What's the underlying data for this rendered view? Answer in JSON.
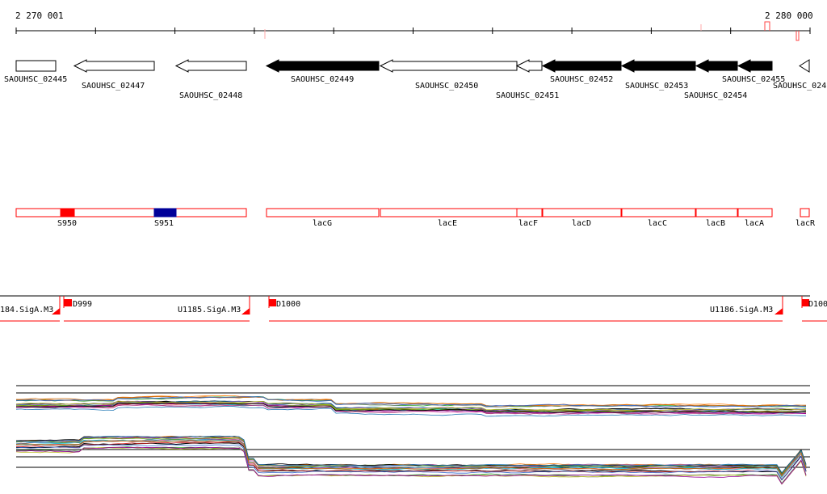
{
  "ruler": {
    "start_label": "2 270 001",
    "end_label": "2 280 000"
  },
  "genes": [
    {
      "label": "SAOUHSC_02445",
      "fill": "white",
      "dir": "box"
    },
    {
      "label": "SAOUHSC_02447",
      "fill": "white",
      "dir": "left"
    },
    {
      "label": "SAOUHSC_02448",
      "fill": "white",
      "dir": "left"
    },
    {
      "label": "SAOUHSC_02449",
      "fill": "black",
      "dir": "left"
    },
    {
      "label": "SAOUHSC_02450",
      "fill": "white",
      "dir": "left"
    },
    {
      "label": "SAOUHSC_02451",
      "fill": "white",
      "dir": "left"
    },
    {
      "label": "SAOUHSC_02452",
      "fill": "black",
      "dir": "left"
    },
    {
      "label": "SAOUHSC_02453",
      "fill": "black",
      "dir": "left"
    },
    {
      "label": "SAOUHSC_02454",
      "fill": "black",
      "dir": "left"
    },
    {
      "label": "SAOUHSC_02455",
      "fill": "black",
      "dir": "left"
    },
    {
      "label": "SAOUHSC_024",
      "fill": "white",
      "dir": "left"
    }
  ],
  "features": [
    {
      "label": "S950",
      "color": "#ff0000"
    },
    {
      "label": "S951",
      "color": "#000099"
    },
    {
      "label": "lacG"
    },
    {
      "label": "lacE"
    },
    {
      "label": "lacF"
    },
    {
      "label": "lacD"
    },
    {
      "label": "lacC"
    },
    {
      "label": "lacB"
    },
    {
      "label": "lacA"
    },
    {
      "label": "lacR"
    }
  ],
  "transcripts": [
    {
      "label": "184.SigA.M3"
    },
    {
      "label": "D999"
    },
    {
      "label": "U1185.SigA.M3"
    },
    {
      "label": "D1000"
    },
    {
      "label": "U1186.SigA.M3"
    },
    {
      "label": "D100"
    }
  ],
  "colors": {
    "accent_red": "#ff0000",
    "feature_blue": "#000099",
    "track_black": "#000000"
  }
}
